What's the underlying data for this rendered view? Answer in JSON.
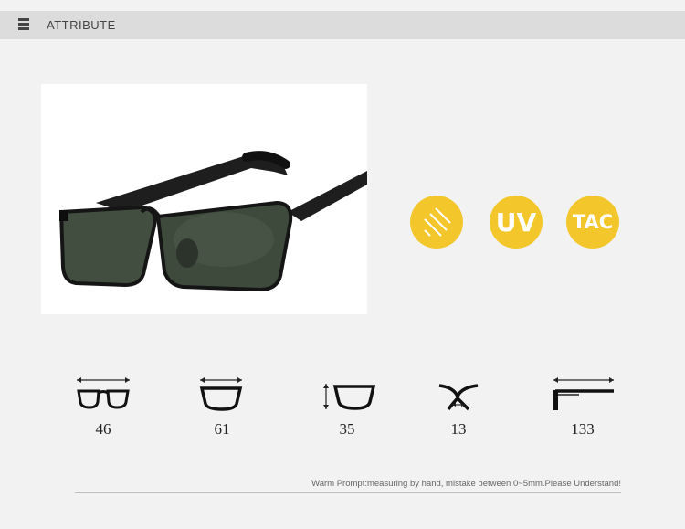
{
  "header": {
    "title": "ATTRIBUTE",
    "menu_icon": "hamburger-icon"
  },
  "product": {
    "image": "sunglasses-photo"
  },
  "badges": [
    {
      "icon": "polarized-lines-icon",
      "label": ""
    },
    {
      "icon": "uv-icon",
      "label": "UV"
    },
    {
      "icon": "tac-icon",
      "label": "TAC"
    }
  ],
  "badge_color": "#f3c72c",
  "measurements": [
    {
      "icon": "lens-width-icon",
      "value": "46"
    },
    {
      "icon": "lens-width-alt-icon",
      "value": "61"
    },
    {
      "icon": "lens-height-icon",
      "value": "35"
    },
    {
      "icon": "bridge-width-icon",
      "value": "13"
    },
    {
      "icon": "temple-length-icon",
      "value": "133"
    }
  ],
  "footer": {
    "warning": "Warm Prompt:measuring by hand, mistake between 0~5mm.Please Understand!"
  }
}
